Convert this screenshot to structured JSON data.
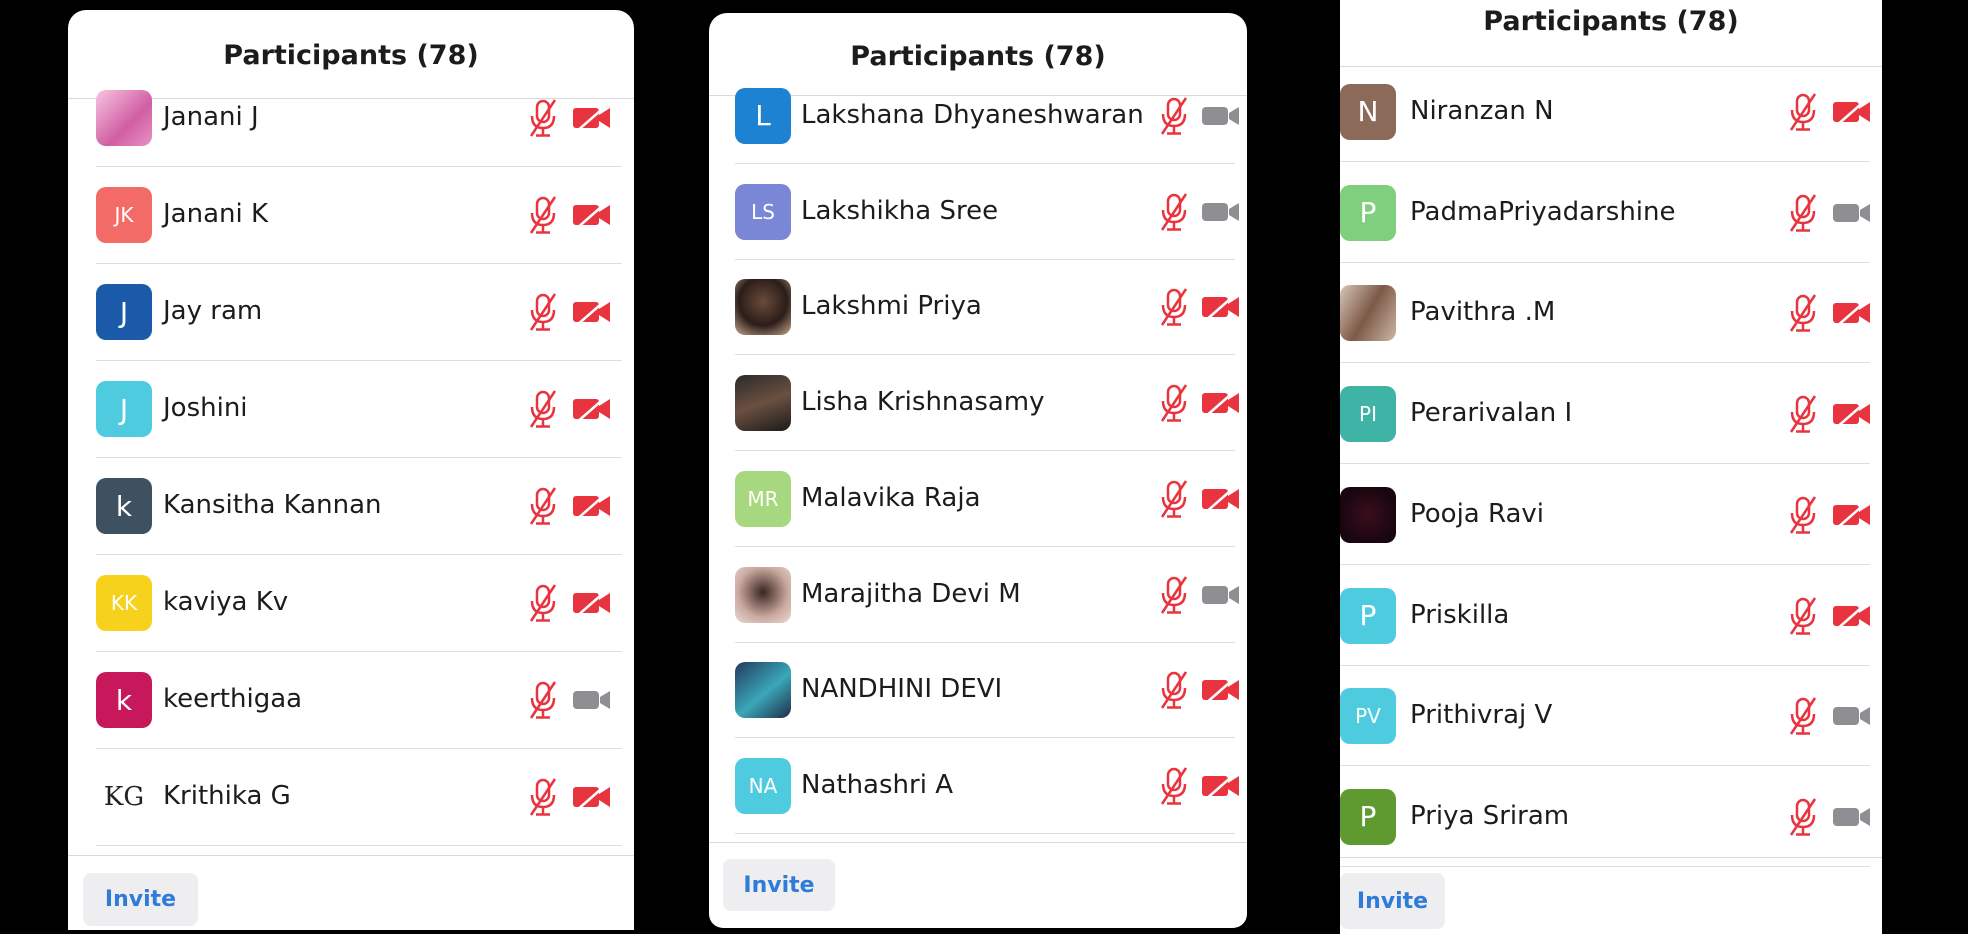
{
  "colors": {
    "muted": "#e8343e",
    "cam_on": "#8e8e93",
    "invite_text": "#2f7bd8"
  },
  "panels": [
    {
      "title": "Participants (78)",
      "invite_label": "Invite",
      "rows": [
        {
          "name": "Janani J",
          "initials": "",
          "avatar_color": "",
          "photo": "ph-a",
          "video": "off"
        },
        {
          "name": "Janani K",
          "initials": "JK",
          "avatar_color": "#f36b67",
          "video": "off"
        },
        {
          "name": "Jay ram",
          "initials": "J",
          "avatar_color": "#1b5aa8",
          "video": "off"
        },
        {
          "name": "Joshini",
          "initials": "J",
          "avatar_color": "#4fcbe0",
          "video": "off"
        },
        {
          "name": "Kansitha Kannan",
          "initials": "k",
          "avatar_color": "#3d5161",
          "video": "off"
        },
        {
          "name": "kaviya Kv",
          "initials": "KK",
          "avatar_color": "#f7d21d",
          "video": "off"
        },
        {
          "name": "keerthigaa",
          "initials": "k",
          "avatar_color": "#c8185c",
          "video": "on"
        },
        {
          "name": "Krithika G",
          "initials": "KG",
          "avatar_color": "",
          "photo": "ph-kg",
          "video": "off"
        }
      ]
    },
    {
      "title": "Participants (78)",
      "invite_label": "Invite",
      "rows": [
        {
          "name": "Lakshana Dhyaneshwaran",
          "initials": "L",
          "avatar_color": "#1e82d2",
          "video": "on"
        },
        {
          "name": "Lakshikha Sree",
          "initials": "LS",
          "avatar_color": "#7a86d6",
          "video": "on"
        },
        {
          "name": "Lakshmi Priya",
          "initials": "",
          "avatar_color": "",
          "photo": "ph-b",
          "video": "off"
        },
        {
          "name": "Lisha Krishnasamy",
          "initials": "",
          "avatar_color": "",
          "photo": "ph-c",
          "video": "off"
        },
        {
          "name": "Malavika Raja",
          "initials": "MR",
          "avatar_color": "#a7d77f",
          "video": "off"
        },
        {
          "name": "Marajitha Devi M",
          "initials": "",
          "avatar_color": "",
          "photo": "ph-d",
          "video": "on"
        },
        {
          "name": "NANDHINI DEVI",
          "initials": "",
          "avatar_color": "",
          "photo": "ph-e",
          "video": "off"
        },
        {
          "name": "Nathashri A",
          "initials": "NA",
          "avatar_color": "#4fcbe0",
          "video": "off"
        }
      ]
    },
    {
      "title": "Participants (78)",
      "invite_label": "Invite",
      "rows": [
        {
          "name": "Niranzan N",
          "initials": "N",
          "avatar_color": "#8c6a5a",
          "video": "off"
        },
        {
          "name": "PadmaPriyadarshine",
          "initials": "P",
          "avatar_color": "#7fcf7f",
          "video": "on"
        },
        {
          "name": "Pavithra .M",
          "initials": "",
          "avatar_color": "",
          "photo": "ph-f",
          "video": "off"
        },
        {
          "name": "Perarivalan I",
          "initials": "PI",
          "avatar_color": "#3fb3a6",
          "video": "off"
        },
        {
          "name": "Pooja Ravi",
          "initials": "",
          "avatar_color": "",
          "photo": "ph-g",
          "video": "off"
        },
        {
          "name": "Priskilla",
          "initials": "P",
          "avatar_color": "#4fcbe0",
          "video": "off"
        },
        {
          "name": "Prithivraj V",
          "initials": "PV",
          "avatar_color": "#4fcbe0",
          "video": "on"
        },
        {
          "name": "Priya Sriram",
          "initials": "P",
          "avatar_color": "#5e9a2f",
          "video": "on"
        }
      ]
    }
  ]
}
